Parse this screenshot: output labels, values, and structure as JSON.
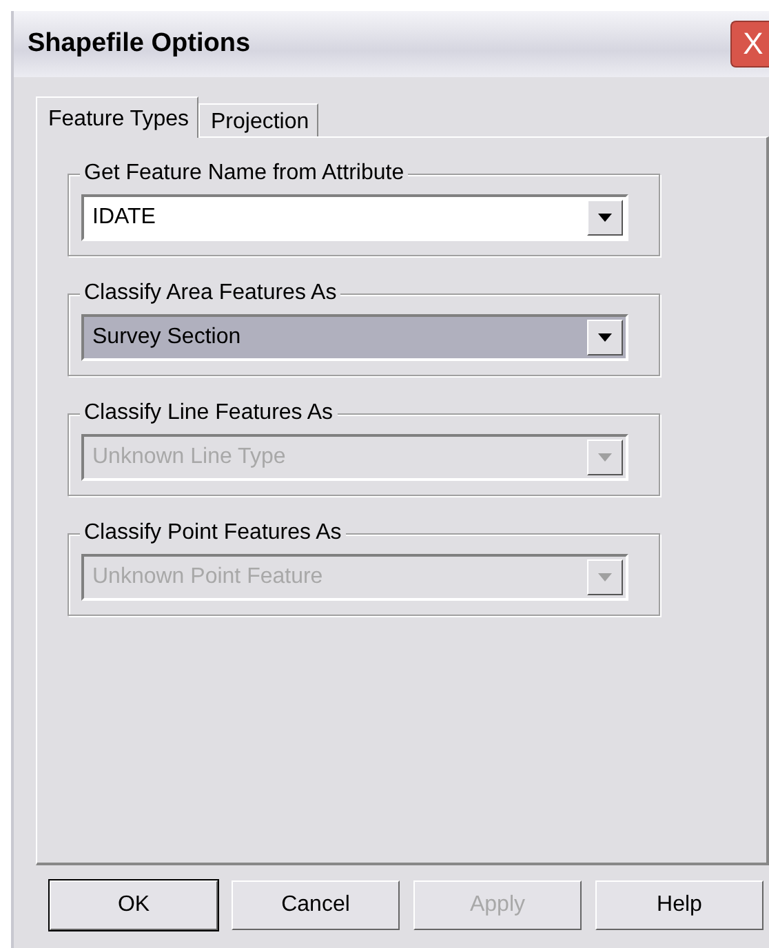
{
  "window": {
    "title": "Shapefile Options",
    "close_button": "X"
  },
  "tabs": [
    {
      "label": "Feature Types",
      "selected": true
    },
    {
      "label": "Projection",
      "selected": false
    }
  ],
  "groups": [
    {
      "label": "Get Feature Name from Attribute",
      "value": "IDATE",
      "disabled": false,
      "focused": false
    },
    {
      "label": "Classify Area Features As",
      "value": "Survey Section",
      "disabled": false,
      "focused": true
    },
    {
      "label": "Classify Line Features As",
      "value": "Unknown Line Type",
      "disabled": true,
      "focused": false
    },
    {
      "label": "Classify Point Features As",
      "value": "Unknown Point Feature",
      "disabled": true,
      "focused": false
    }
  ],
  "buttons": [
    {
      "label": "OK",
      "disabled": false,
      "default": true
    },
    {
      "label": "Cancel",
      "disabled": false,
      "default": false
    },
    {
      "label": "Apply",
      "disabled": true,
      "default": false
    },
    {
      "label": "Help",
      "disabled": false,
      "default": false
    }
  ]
}
